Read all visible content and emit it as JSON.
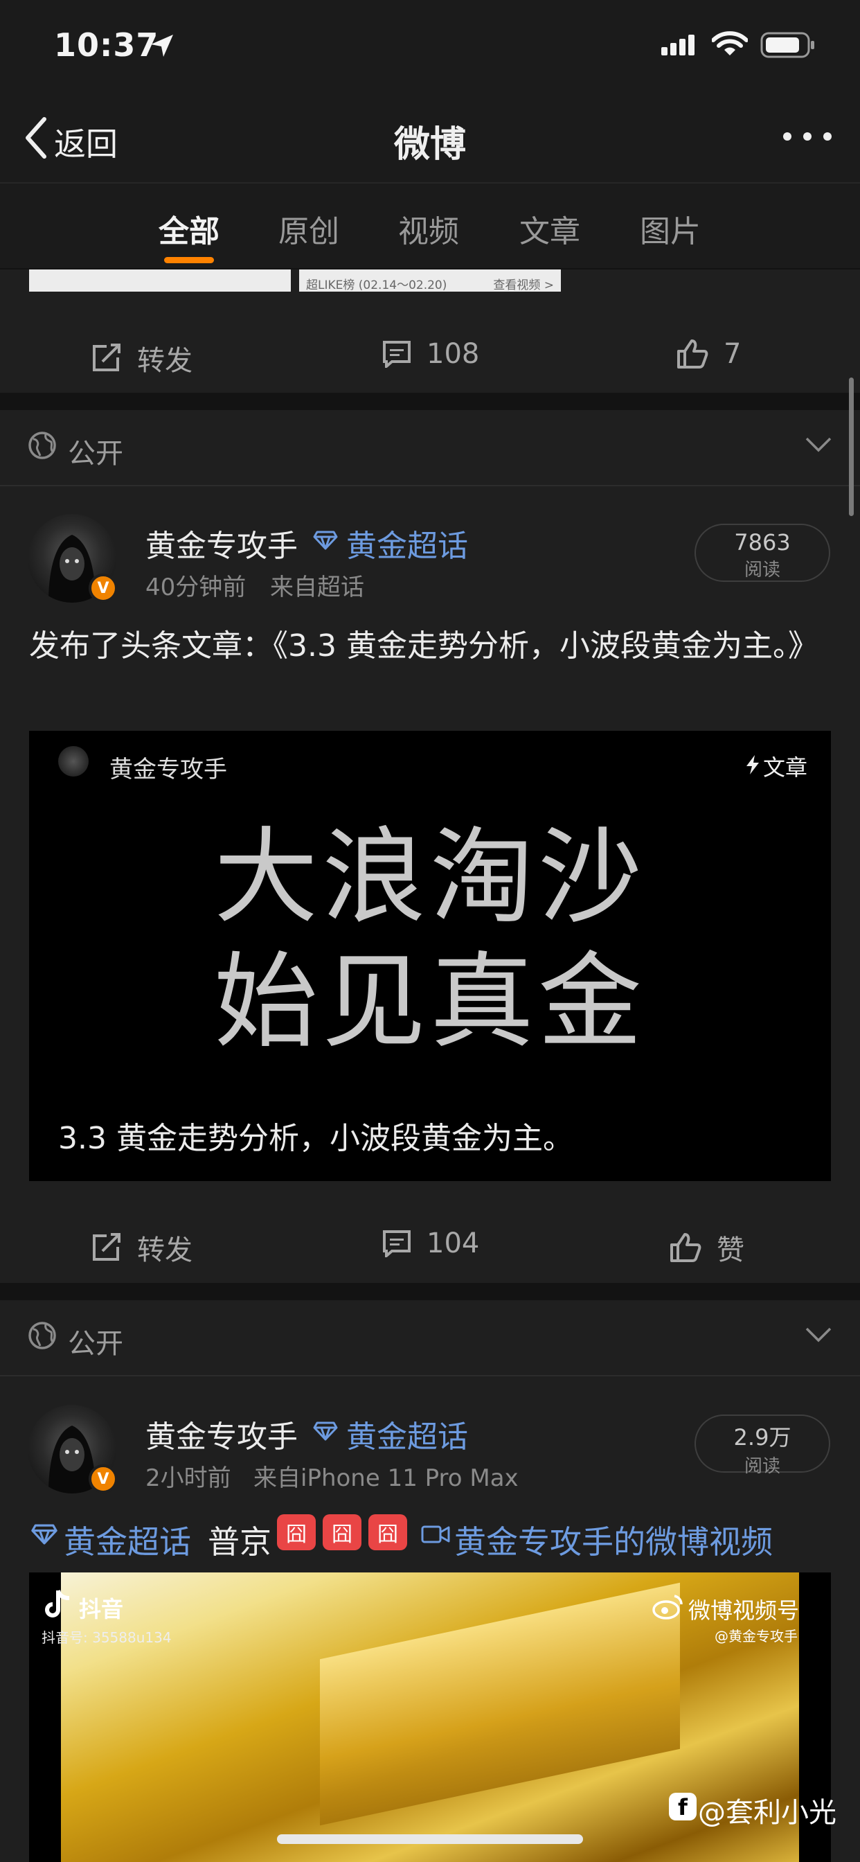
{
  "status_bar": {
    "time": "10:37"
  },
  "nav": {
    "back_label": "返回",
    "title": "微博"
  },
  "tabs": [
    {
      "label": "全部",
      "active": true
    },
    {
      "label": "原创",
      "active": false
    },
    {
      "label": "视频",
      "active": false
    },
    {
      "label": "文章",
      "active": false
    },
    {
      "label": "图片",
      "active": false
    }
  ],
  "prev_post": {
    "thumbs": [
      "超LIKE榜 (02.14～02.20)"
    ],
    "thumb_right_link": "查看视频 >",
    "actions": {
      "repost_label": "转发",
      "comments": "108",
      "likes": "7"
    }
  },
  "posts": [
    {
      "visibility": "公开",
      "author": "黄金专攻手",
      "topic": "黄金超话",
      "time": "40分钟前",
      "source": "来自超话",
      "reads": {
        "value": "7863",
        "label": "阅读"
      },
      "text": "发布了头条文章：《3.3 黄金走势分析，小波段黄金为主。》",
      "article": {
        "author": "黄金专攻手",
        "tag": "文章",
        "headline_line1": "大浪淘沙",
        "headline_line2": "始见真金",
        "caption": "3.3 黄金走势分析，小波段黄金为主。"
      },
      "actions": {
        "repost_label": "转发",
        "comments": "104",
        "like_label": "赞"
      }
    },
    {
      "visibility": "公开",
      "author": "黄金专攻手",
      "topic": "黄金超话",
      "time": "2小时前",
      "source": "来自iPhone 11 Pro Max",
      "reads": {
        "value": "2.9万",
        "label": "阅读"
      },
      "text_topic": "黄金超话",
      "text_plain": "普京",
      "text_emoji": [
        "囧",
        "囧",
        "囧"
      ],
      "video_link": "黄金专攻手的微博视频",
      "video": {
        "app": "抖音",
        "douyin_id": "抖音号: 35588u134",
        "watermark": "微博视频号",
        "watermark_sub": "@黄金专攻手"
      }
    }
  ],
  "overlay": {
    "watermark": "@套利小光"
  },
  "colors": {
    "accent_orange": "#ff8200",
    "link_blue": "#6d9be0",
    "background": "#131313",
    "card": "#1f1f1f"
  }
}
